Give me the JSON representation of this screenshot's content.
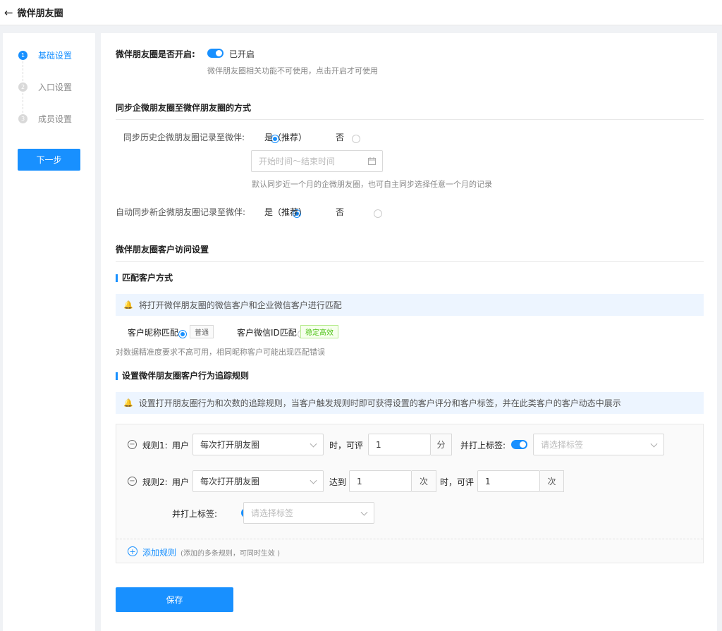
{
  "header": {
    "back_icon": "←",
    "title": "微伴朋友圈"
  },
  "steps": [
    {
      "num": "1",
      "label": "基础设置"
    },
    {
      "num": "2",
      "label": "入口设置"
    },
    {
      "num": "3",
      "label": "成员设置"
    }
  ],
  "next_button": "下一步",
  "enable": {
    "label": "微伴朋友圈是否开启:",
    "state": "已开启",
    "hint": "微伴朋友圈相关功能不可使用，点击开启才可使用"
  },
  "sync": {
    "title": "同步企微朋友圈至微伴朋友圈的方式",
    "history_label": "同步历史企微朋友圈记录至微伴:",
    "yes": "是（推荐）",
    "no": "否",
    "date_placeholder": "开始时间～结束时间",
    "history_hint": "默认同步近一个月的企微朋友圈，也可自主同步选择任意一个月的记录",
    "auto_label": "自动同步新企微朋友圈记录至微伴:"
  },
  "visit": {
    "title": "微伴朋友圈客户访问设置",
    "match_title": "匹配客户方式",
    "match_notice": "将打开微伴朋友圈的微信客户和企业微信客户进行匹配",
    "opt1": "客户昵称匹配",
    "opt1_tag": "普通",
    "opt2": "客户微信ID匹配",
    "opt2_tag": "稳定高效",
    "match_hint": "对数据精准度要求不高可用，相同昵称客户可能出现匹配错误",
    "rules_title": "设置微伴朋友圈客户行为追踪规则",
    "rules_notice": "设置打开朋友圈行为和次数的追踪规则，当客户触发规则时即可获得设置的客户评分和客户标签，并在此类客户的客户动态中展示"
  },
  "rule1": {
    "label": "规则1:",
    "user": "用户",
    "action": "每次打开朋友圈",
    "when": "时，可评",
    "score": "1",
    "unit": "分",
    "tag_label": "并打上标签:",
    "tag_placeholder": "请选择标签"
  },
  "rule2": {
    "label": "规则2:",
    "user": "用户",
    "action": "每次打开朋友圈",
    "reach": "达到",
    "count": "1",
    "unit": "次",
    "when": "时，可评",
    "score": "1",
    "unit2": "次",
    "tag_label": "并打上标签:",
    "tag_placeholder": "请选择标签"
  },
  "add_rule": {
    "label": "添加规则",
    "hint": "(添加的多条规则，可同时生效 )"
  },
  "save_button": "保存"
}
